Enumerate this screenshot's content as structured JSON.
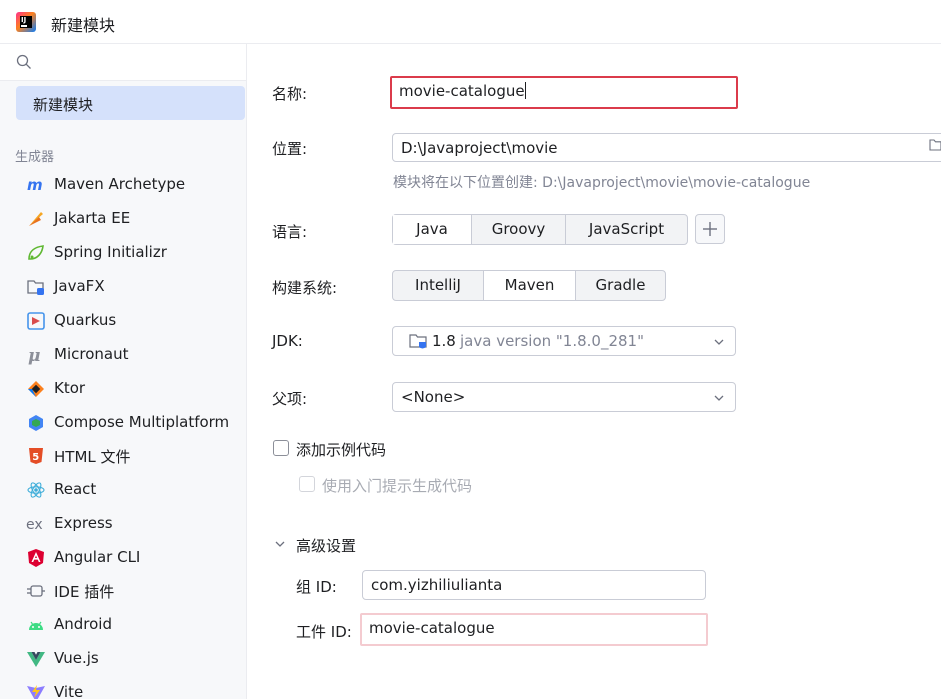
{
  "window": {
    "title": "新建模块"
  },
  "sidebar": {
    "search_placeholder": "",
    "selected_item": "新建模块",
    "section_label": "生成器",
    "generators": [
      {
        "label": "Maven Archetype",
        "icon": "maven-icon"
      },
      {
        "label": "Jakarta EE",
        "icon": "jakarta-ee-icon"
      },
      {
        "label": "Spring Initializr",
        "icon": "spring-icon"
      },
      {
        "label": "JavaFX",
        "icon": "javafx-icon"
      },
      {
        "label": "Quarkus",
        "icon": "quarkus-icon"
      },
      {
        "label": "Micronaut",
        "icon": "micronaut-icon"
      },
      {
        "label": "Ktor",
        "icon": "ktor-icon"
      },
      {
        "label": "Compose Multiplatform",
        "icon": "compose-icon"
      },
      {
        "label": "HTML 文件",
        "icon": "html5-icon"
      },
      {
        "label": "React",
        "icon": "react-icon"
      },
      {
        "label": "Express",
        "icon": "express-icon"
      },
      {
        "label": "Angular CLI",
        "icon": "angular-icon"
      },
      {
        "label": "IDE 插件",
        "icon": "plugin-icon"
      },
      {
        "label": "Android",
        "icon": "android-icon"
      },
      {
        "label": "Vue.js",
        "icon": "vue-icon"
      },
      {
        "label": "Vite",
        "icon": "vite-icon"
      }
    ]
  },
  "form": {
    "name": {
      "label": "名称:",
      "value": "movie-catalogue"
    },
    "location": {
      "label": "位置:",
      "value": "D:\\Javaproject\\movie",
      "hint": "模块将在以下位置创建: D:\\Javaproject\\movie\\movie-catalogue"
    },
    "language": {
      "label": "语言:",
      "options": [
        "Java",
        "Groovy",
        "JavaScript"
      ],
      "selected": "Java"
    },
    "build_system": {
      "label": "构建系统:",
      "options": [
        "IntelliJ",
        "Maven",
        "Gradle"
      ],
      "selected": "Maven"
    },
    "jdk": {
      "label": "JDK:",
      "version": "1.8",
      "detail": "java version \"1.8.0_281\""
    },
    "parent": {
      "label": "父项:",
      "value": "<None>"
    },
    "add_sample_code": {
      "label": "添加示例代码",
      "checked": false
    },
    "onboarding_tips": {
      "label": "使用入门提示生成代码",
      "checked": false,
      "disabled": true
    },
    "advanced": {
      "label": "高级设置",
      "group_id": {
        "label": "组 ID:",
        "value": "com.yizhiliulianta"
      },
      "artifact_id": {
        "label": "工件 ID:",
        "value": "movie-catalogue"
      }
    }
  },
  "colors": {
    "accent": "#3574f0",
    "selection": "#d5e1fb",
    "error_border": "#db3b4b"
  }
}
